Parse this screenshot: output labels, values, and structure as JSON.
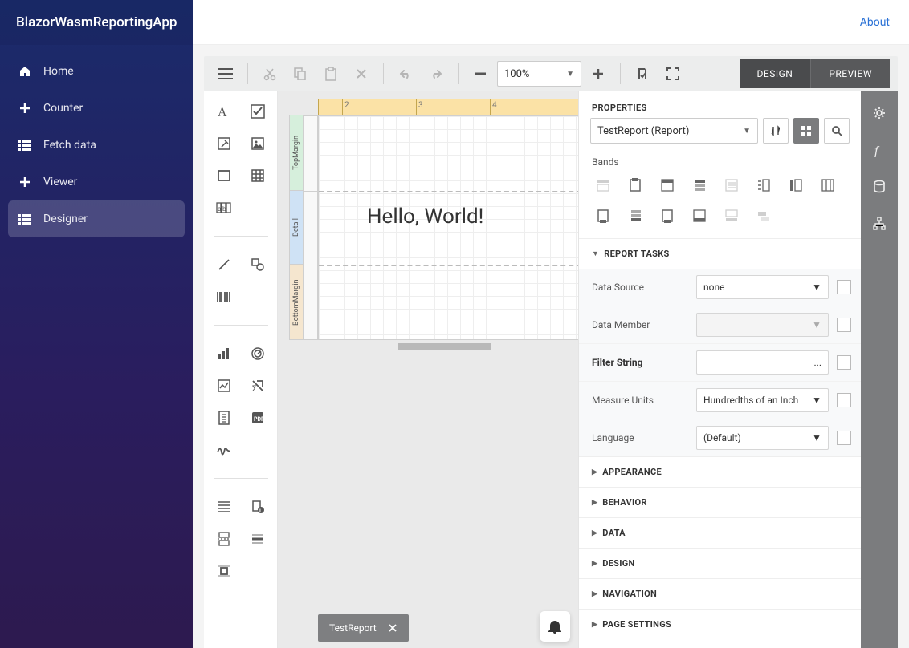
{
  "brand": "BlazorWasmReportingApp",
  "topbar": {
    "about": "About"
  },
  "nav": {
    "items": [
      {
        "label": "Home",
        "icon": "home-icon"
      },
      {
        "label": "Counter",
        "icon": "plus-icon"
      },
      {
        "label": "Fetch data",
        "icon": "list-icon"
      },
      {
        "label": "Viewer",
        "icon": "plus-icon"
      },
      {
        "label": "Designer",
        "icon": "list-icon"
      }
    ],
    "activeIndex": 4
  },
  "toolbar": {
    "zoom": "100%",
    "modes": {
      "design": "DESIGN",
      "preview": "PREVIEW"
    }
  },
  "ruler": {
    "ticks": [
      "2",
      "3",
      "4"
    ]
  },
  "bands": {
    "top": "TopMargin",
    "detail": "Detail",
    "bottom": "BottomMargin"
  },
  "canvas": {
    "hello": "Hello, World!"
  },
  "tabs": {
    "current": "TestReport"
  },
  "properties": {
    "title": "PROPERTIES",
    "selector": "TestReport (Report)",
    "bandsLabel": "Bands",
    "sections": {
      "reportTasks": "REPORT TASKS",
      "appearance": "APPEARANCE",
      "behavior": "BEHAVIOR",
      "data": "DATA",
      "design": "DESIGN",
      "navigation": "NAVIGATION",
      "pageSettings": "PAGE SETTINGS"
    },
    "rows": {
      "dataSource": {
        "label": "Data Source",
        "value": "none"
      },
      "dataMember": {
        "label": "Data Member",
        "value": ""
      },
      "filterString": {
        "label": "Filter String",
        "value": "",
        "ellipsis": "..."
      },
      "measureUnits": {
        "label": "Measure Units",
        "value": "Hundredths of an Inch"
      },
      "language": {
        "label": "Language",
        "value": "(Default)"
      }
    }
  }
}
